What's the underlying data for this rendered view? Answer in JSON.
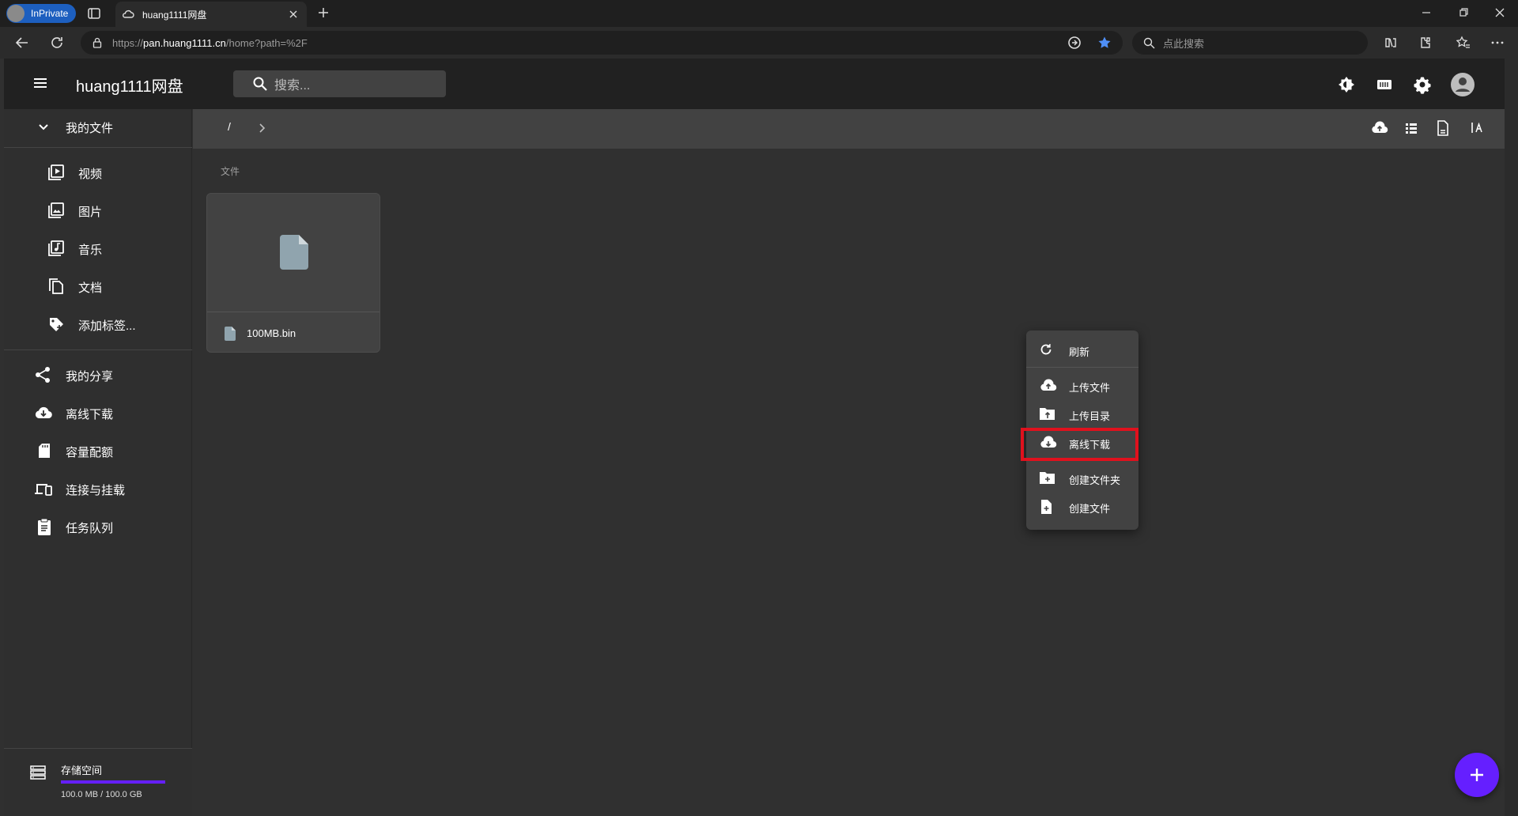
{
  "browser": {
    "inprivate_label": "InPrivate",
    "tab_title": "huang1111网盘",
    "url_scheme": "https://",
    "url_host": "pan.huang1111.cn",
    "url_path": "/home?path=%2F",
    "search_placeholder": "点此搜索"
  },
  "app": {
    "title": "huang1111网盘",
    "search_placeholder": "搜索..."
  },
  "sidebar": {
    "my_files": "我的文件",
    "items": [
      {
        "label": "视频",
        "icon": "video-icon"
      },
      {
        "label": "图片",
        "icon": "image-icon"
      },
      {
        "label": "音乐",
        "icon": "music-icon"
      },
      {
        "label": "文档",
        "icon": "document-icon"
      },
      {
        "label": "添加标签...",
        "icon": "add-tag-icon"
      }
    ],
    "items2": [
      {
        "label": "我的分享",
        "icon": "share-icon"
      },
      {
        "label": "离线下载",
        "icon": "cloud-download-icon"
      },
      {
        "label": "容量配额",
        "icon": "sd-card-icon"
      },
      {
        "label": "连接与挂载",
        "icon": "devices-icon"
      },
      {
        "label": "任务队列",
        "icon": "clipboard-icon"
      }
    ],
    "storage_label": "存储空间",
    "storage_usage": "100.0 MB / 100.0 GB",
    "storage_fraction": 1.0
  },
  "breadcrumb": {
    "root": "/"
  },
  "main": {
    "section_label": "文件",
    "files": [
      {
        "name": "100MB.bin"
      }
    ]
  },
  "context_menu": {
    "refresh": "刷新",
    "upload_file": "上传文件",
    "upload_dir": "上传目录",
    "offline_download": "离线下载",
    "create_folder": "创建文件夹",
    "create_file": "创建文件"
  },
  "colors": {
    "accent": "#651fff",
    "highlight": "#e0111d"
  }
}
